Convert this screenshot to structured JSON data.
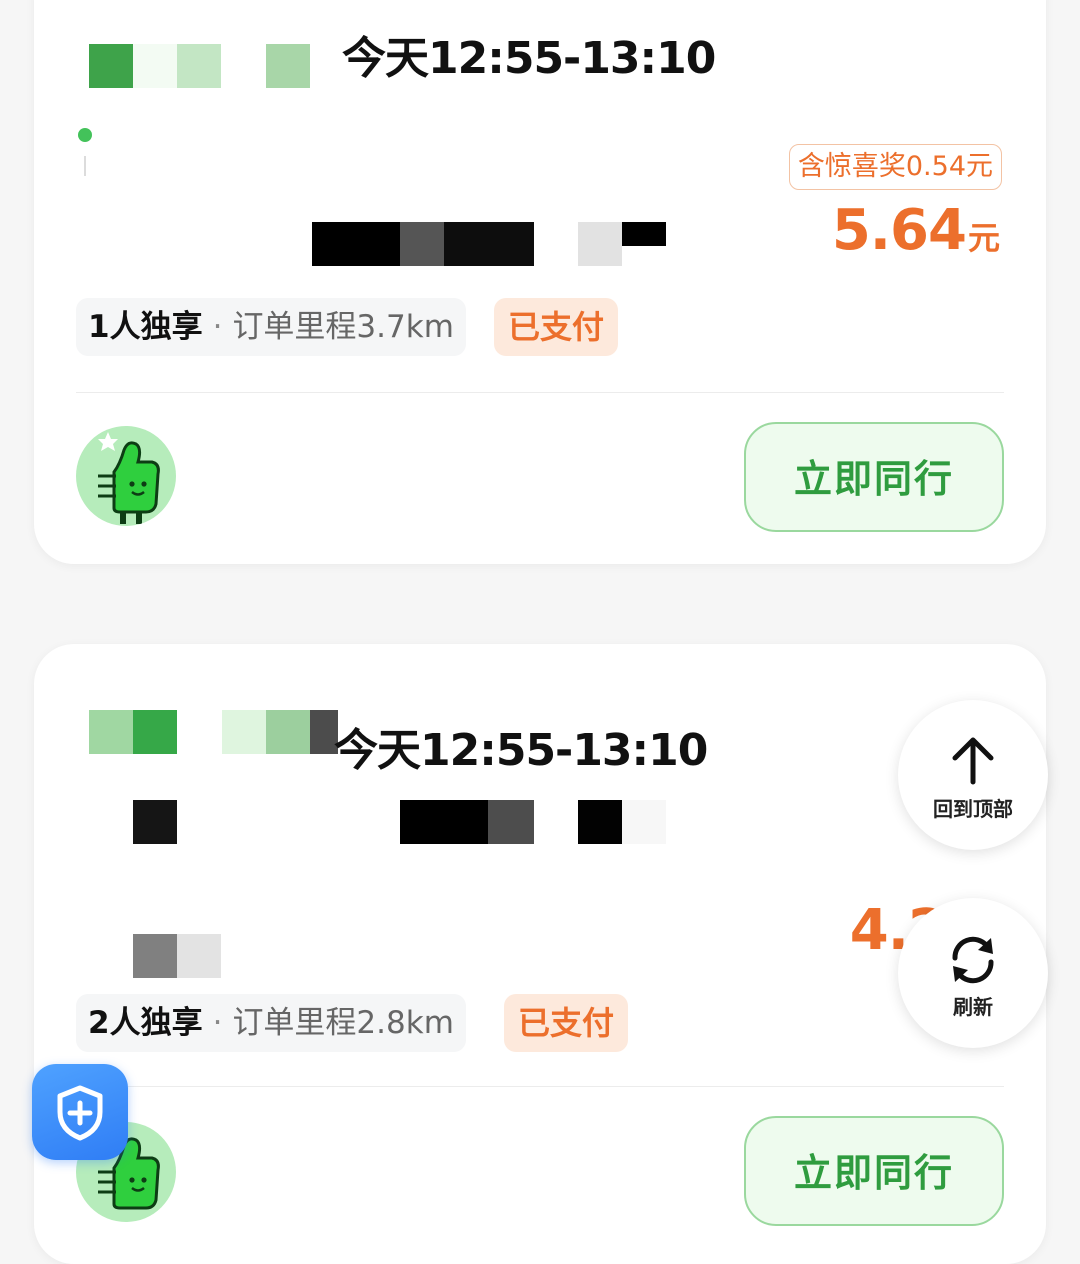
{
  "orders": [
    {
      "time": "今天12:55-13:10",
      "surprise_label": "含惊喜奖0.54元",
      "price": "5.64",
      "price_unit": "元",
      "passengers": "1人独享",
      "separator": "·",
      "distance": "订单里程3.7km",
      "status": "已支付",
      "action": "立即同行"
    },
    {
      "time": "今天12:55-13:10",
      "price": "4.2",
      "passengers": "2人独享",
      "separator": "·",
      "distance": "订单里程2.8km",
      "status": "已支付",
      "action": "立即同行"
    }
  ],
  "floating": {
    "back_to_top": "回到顶部",
    "refresh": "刷新"
  },
  "icons": {
    "back_to_top": "arrow-up-icon",
    "refresh": "refresh-icon",
    "safety": "shield-plus-icon",
    "avatar": "thumbs-up-mascot"
  },
  "colors": {
    "accent_orange": "#ec6f2c",
    "accent_green": "#2f9c3f",
    "green_button_bg": "#eefbee",
    "paid_bg": "#fde9dc"
  }
}
